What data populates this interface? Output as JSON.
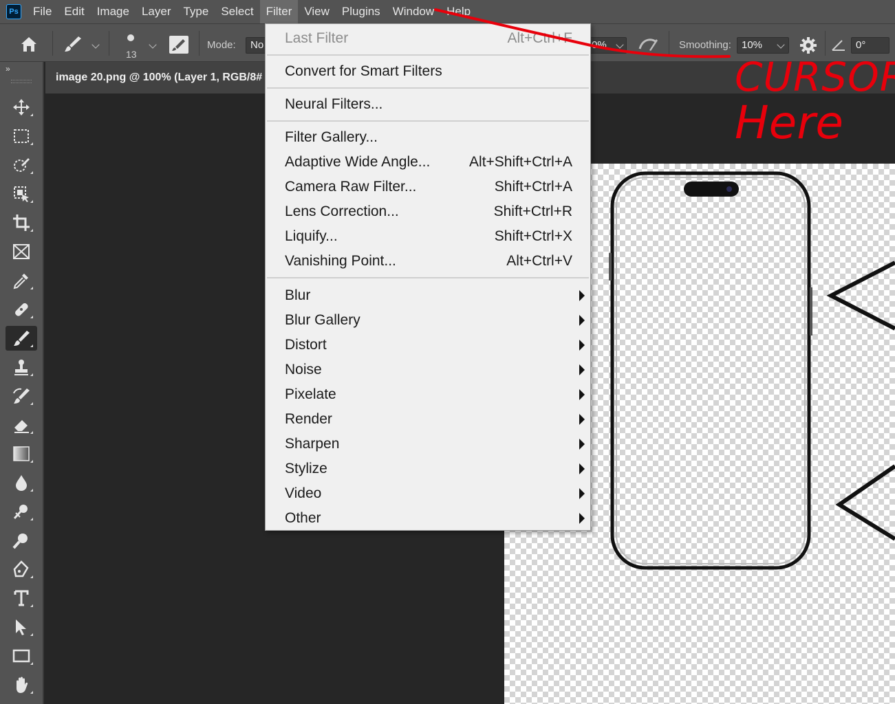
{
  "app": {
    "logo": "Ps"
  },
  "menubar": {
    "items": [
      "File",
      "Edit",
      "Image",
      "Layer",
      "Type",
      "Select",
      "Filter",
      "View",
      "Plugins",
      "Window",
      "Help"
    ],
    "active": "Filter"
  },
  "options_bar": {
    "brush_size": "13",
    "mode_label": "Mode:",
    "mode_value": "No",
    "opacity_value": "0%",
    "smoothing_label": "Smoothing:",
    "smoothing_value": "10%",
    "angle_value": "0°"
  },
  "document": {
    "tab_title": "image 20.png @ 100% (Layer 1, RGB/8#"
  },
  "toolbar": {
    "collapse_glyph": "»",
    "selected_tool": "brush-tool",
    "tools": [
      "move-tool",
      "rectangular-marquee-tool",
      "quick-selection-tool",
      "object-selection-tool",
      "crop-tool",
      "frame-tool",
      "eyedropper-tool",
      "spot-healing-brush-tool",
      "brush-tool",
      "clone-stamp-tool",
      "history-brush-tool",
      "eraser-tool",
      "gradient-tool",
      "blur-tool",
      "dodge-tool",
      "zoom-tool",
      "pen-tool",
      "type-tool",
      "path-selection-tool",
      "rectangle-tool",
      "hand-tool"
    ]
  },
  "filter_menu": {
    "last_filter": {
      "label": "Last Filter",
      "shortcut": "Alt+Ctrl+F",
      "enabled": false
    },
    "convert": {
      "label": "Convert for Smart Filters"
    },
    "neural": {
      "label": "Neural Filters..."
    },
    "group_specials": [
      {
        "label": "Filter Gallery...",
        "shortcut": ""
      },
      {
        "label": "Adaptive Wide Angle...",
        "shortcut": "Alt+Shift+Ctrl+A"
      },
      {
        "label": "Camera Raw Filter...",
        "shortcut": "Shift+Ctrl+A"
      },
      {
        "label": "Lens Correction...",
        "shortcut": "Shift+Ctrl+R"
      },
      {
        "label": "Liquify...",
        "shortcut": "Shift+Ctrl+X"
      },
      {
        "label": "Vanishing Point...",
        "shortcut": "Alt+Ctrl+V"
      }
    ],
    "submenus": [
      "Blur",
      "Blur Gallery",
      "Distort",
      "Noise",
      "Pixelate",
      "Render",
      "Sharpen",
      "Stylize",
      "Video",
      "Other"
    ]
  },
  "annotation": {
    "line1": "CURSOR",
    "line2": "Here",
    "color": "#e8000b"
  }
}
